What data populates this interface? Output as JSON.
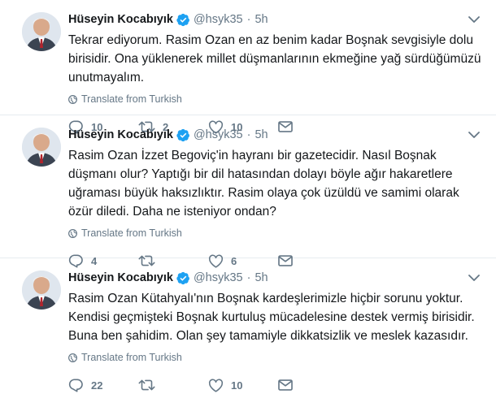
{
  "tweets": [
    {
      "name": "Hüseyin Kocabıyık",
      "handle": "@hsyk35",
      "time": "5h",
      "text": "Tekrar ediyorum. Rasim Ozan en az benim kadar Boşnak sevgisiyle dolu birisidir. Ona yüklenerek millet düşmanlarının ekmeğine yağ sürdüğümüzü unutmayalım.",
      "translate": "Translate from Turkish",
      "replies": "10",
      "retweets": "2",
      "likes": "10",
      "message": ""
    },
    {
      "name": "Hüseyin Kocabıyık",
      "handle": "@hsyk35",
      "time": "5h",
      "text": "Rasim Ozan İzzet Begoviç'in hayranı bir gazetecidir. Nasıl Boşnak düşmanı olur? Yaptığı bir dil hatasından dolayı böyle ağır hakaretlere uğraması büyük haksızlıktır. Rasim olaya çok üzüldü ve samimi olarak özür diledi. Daha ne isteniyor ondan?",
      "translate": "Translate from Turkish",
      "replies": "4",
      "retweets": "",
      "likes": "6",
      "message": ""
    },
    {
      "name": "Hüseyin Kocabıyık",
      "handle": "@hsyk35",
      "time": "5h",
      "text": "Rasim Ozan Kütahyalı'nın Boşnak kardeşlerimizle hiçbir sorunu yoktur. Kendisi geçmişteki Boşnak kurtuluş mücadelesine destek vermiş birisidir. Buna ben şahidim. Olan şey tamamiyle dikkatsizlik ve meslek kazasıdır.",
      "translate": "Translate from Turkish",
      "replies": "22",
      "retweets": "",
      "likes": "10",
      "message": ""
    }
  ],
  "colors": {
    "verified": "#1da1f2",
    "muted": "#657786",
    "text": "#14171a",
    "divider": "#e6ecf0"
  },
  "icons": [
    "verified-badge-icon",
    "chevron-down-icon",
    "globe-icon",
    "reply-icon",
    "retweet-icon",
    "like-icon",
    "direct-message-icon"
  ]
}
